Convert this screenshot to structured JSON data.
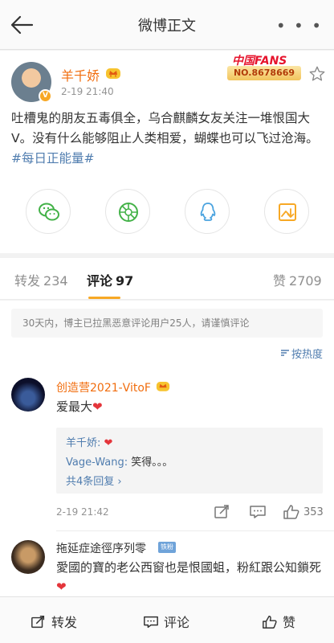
{
  "nav": {
    "title": "微博正文",
    "more": "• • •"
  },
  "post": {
    "author": "羊千娇",
    "time": "2-19 21:40",
    "fans_logo": "中国FANS",
    "fans_no": "NO.8678669",
    "text_main": "吐槽鬼的朋友五毒俱全，乌合麒麟女友关注一堆恨国大V。没有什么能够阻止人类相爱，蝴蝶也可以飞过沧海。",
    "hashtag": "#每日正能量#"
  },
  "tabs": {
    "repost_label": "转发",
    "repost_count": "234",
    "comment_label": "评论",
    "comment_count": "97",
    "like_label": "赞",
    "like_count": "2709"
  },
  "comments": {
    "notice": "30天内，博主已拉黑恶意评论用户25人，请谨慎评论",
    "sort_label": "按热度",
    "items": [
      {
        "name": "创造营2021-VitoF",
        "text": "爱最大",
        "heart": "❤",
        "replies": [
          {
            "name": "羊千娇:",
            "text": "",
            "heart": "❤"
          },
          {
            "name": "Vage-Wang:",
            "text": "笑得。。。",
            "heart": ""
          }
        ],
        "more_replies": "共4条回复 ›",
        "time": "2-19 21:42",
        "likes": "353"
      },
      {
        "name": "拖延症途徑序列零",
        "fan_tag": "铁粉",
        "text": "愛國的寶的老公西窗也是恨國蛆，粉紅跟公知鎖死",
        "heart": "❤"
      }
    ]
  },
  "bottom": {
    "repost": "转发",
    "comment": "评论",
    "like": "赞"
  },
  "colors": {
    "accent": "#f7a825",
    "name_orange": "#f16d0e",
    "link_blue": "#507daf"
  }
}
